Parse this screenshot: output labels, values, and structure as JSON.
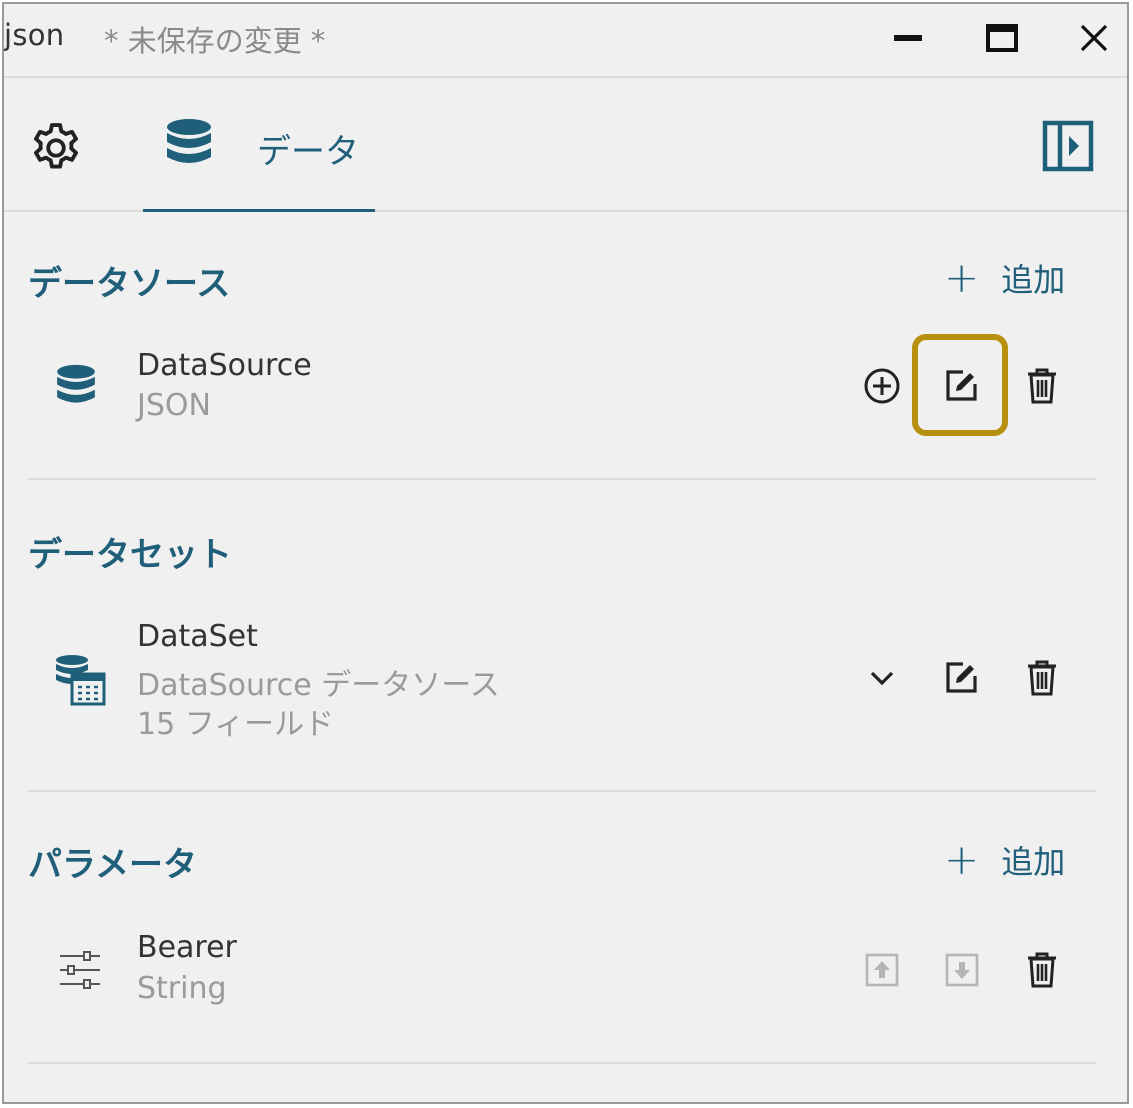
{
  "window": {
    "title": "json",
    "unsaved": "* 未保存の変更 *"
  },
  "tabs": {
    "data_label": "データ"
  },
  "datasource_section": {
    "title": "データソース",
    "add_label": "追加",
    "item": {
      "name": "DataSource",
      "type": "JSON"
    }
  },
  "dataset_section": {
    "title": "データセット",
    "item": {
      "name": "DataSet",
      "source": "DataSource データソース",
      "fields": "15 フィールド"
    }
  },
  "parameter_section": {
    "title": "パラメータ",
    "add_label": "追加",
    "item": {
      "name": "Bearer",
      "type": "String"
    }
  },
  "colors": {
    "accent": "#1f5f7a",
    "highlight": "#b8900f",
    "icon": "#333333",
    "disabled_icon": "#b5b5b5"
  },
  "icons": [
    "gear-icon",
    "database-icon",
    "panel-toggle-icon",
    "plus-icon",
    "add-circle-icon",
    "edit-icon",
    "trash-icon",
    "dataset-table-icon",
    "chevron-down-icon",
    "sliders-icon",
    "move-up-icon",
    "move-down-icon"
  ]
}
